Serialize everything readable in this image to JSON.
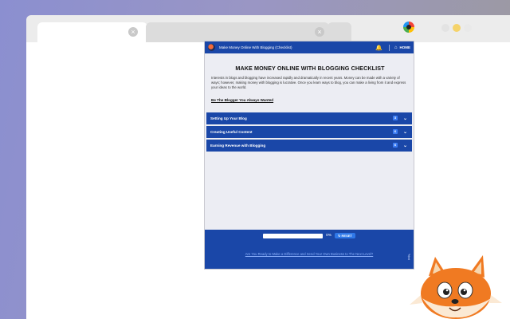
{
  "browser": {
    "tabs": [
      {
        "label": "",
        "active": true
      },
      {
        "label": "",
        "active": false
      },
      {
        "label": "",
        "active": false
      }
    ],
    "close_glyph": "×",
    "extension_icon": "extension-logo-icon",
    "window_controls": [
      "#e6e6e6",
      "#f2c94c",
      "#e9e9e9"
    ]
  },
  "popup": {
    "header": {
      "title": "Make Money Online With Blogging (Checklist)",
      "bell_icon": "🔔",
      "home_icon": "⌂",
      "home_label": "HOME"
    },
    "intro": {
      "heading": "MAKE MONEY ONLINE WITH BLOGGING CHECKLIST",
      "paragraph": "Interests in blogs and blogging have increased rapidly and dramatically in recent years. Money can be made with a variety of ways; however, making money with blogging is lucrative. Once you learn ways to blog, you can make a living from it and express your ideas to the world.",
      "link": "Be The Blogger You Always Wanted"
    },
    "sections": [
      {
        "label": "Setting Up Your Blog",
        "count": "3"
      },
      {
        "label": "Creating Useful Content",
        "count": "6"
      },
      {
        "label": "Earning Revenue with Blogging",
        "count": "6"
      }
    ],
    "chevron": "⌄",
    "footer": {
      "progress_value": 0,
      "progress_label": "0%",
      "reset_label": "↻ RESET",
      "cta": "Are You Ready to Make a Difference and Send Your Own Business to The Next Level?",
      "facebook_icon": "f"
    }
  },
  "colors": {
    "brand_blue": "#1a47a8",
    "badge_blue": "#3c7cf2"
  },
  "mascot": "fox-mascot"
}
